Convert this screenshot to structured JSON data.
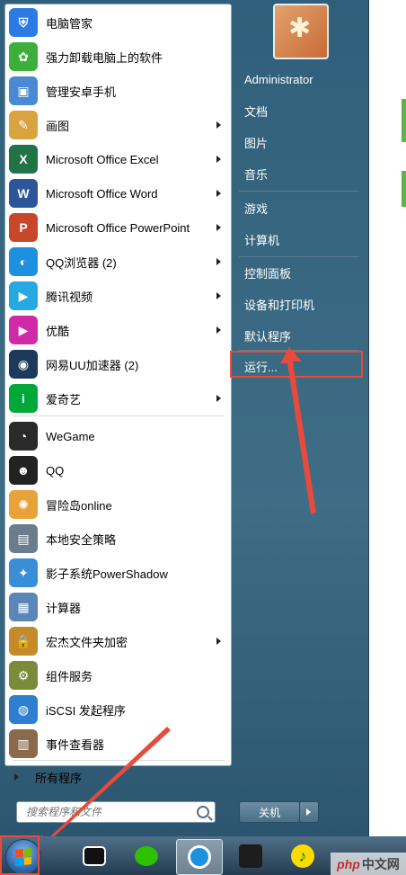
{
  "left_pane": {
    "apps": [
      {
        "label": "电脑管家",
        "icon": "tencent-pc-manager-icon",
        "color": "#2c7be5",
        "glyph": "⛨",
        "arrow": false
      },
      {
        "label": "强力卸载电脑上的软件",
        "icon": "uninstall-clover-icon",
        "color": "#3cae3c",
        "glyph": "✿",
        "arrow": false
      },
      {
        "label": "管理安卓手机",
        "icon": "android-manager-icon",
        "color": "#4a8ad4",
        "glyph": "▣",
        "arrow": false
      },
      {
        "label": "画图",
        "icon": "paint-palette-icon",
        "color": "#d9a440",
        "glyph": "✎",
        "arrow": true
      },
      {
        "label": "Microsoft Office Excel",
        "icon": "excel-icon",
        "color": "#217346",
        "glyph": "X",
        "arrow": true
      },
      {
        "label": "Microsoft Office Word",
        "icon": "word-icon",
        "color": "#2b579a",
        "glyph": "W",
        "arrow": true
      },
      {
        "label": "Microsoft Office PowerPoint",
        "icon": "powerpoint-icon",
        "color": "#c8472a",
        "glyph": "P",
        "arrow": true
      },
      {
        "label": "QQ浏览器 (2)",
        "icon": "qq-browser-icon",
        "color": "#1e90e0",
        "glyph": "◐",
        "arrow": true
      },
      {
        "label": "腾讯视频",
        "icon": "tencent-video-icon",
        "color": "#27a8e0",
        "glyph": "▶",
        "arrow": true
      },
      {
        "label": "优酷",
        "icon": "youku-icon",
        "color": "#d12aa8",
        "glyph": "▶",
        "arrow": true
      },
      {
        "label": "网易UU加速器 (2)",
        "icon": "uu-accelerator-icon",
        "color": "#1d3a5a",
        "glyph": "◉",
        "arrow": false
      },
      {
        "label": "爱奇艺",
        "icon": "iqiyi-icon",
        "color": "#00a83a",
        "glyph": "i",
        "arrow": true
      },
      {
        "label": "WeGame",
        "icon": "wegame-icon",
        "color": "#2a2a2a",
        "glyph": "◔",
        "arrow": false
      },
      {
        "label": "QQ",
        "icon": "qq-penguin-icon",
        "color": "#222222",
        "glyph": "☻",
        "arrow": false
      },
      {
        "label": "冒险岛online",
        "icon": "maplestory-icon",
        "color": "#e8a23a",
        "glyph": "✺",
        "arrow": false
      },
      {
        "label": "本地安全策略",
        "icon": "local-security-policy-icon",
        "color": "#6b7c8c",
        "glyph": "▤",
        "arrow": false
      },
      {
        "label": "影子系统PowerShadow",
        "icon": "powershadow-icon",
        "color": "#3a8ed8",
        "glyph": "✦",
        "arrow": false
      },
      {
        "label": "计算器",
        "icon": "calculator-icon",
        "color": "#5a86b8",
        "glyph": "▦",
        "arrow": false
      },
      {
        "label": "宏杰文件夹加密",
        "icon": "folder-lock-icon",
        "color": "#c58a2a",
        "glyph": "🔒",
        "arrow": true
      },
      {
        "label": "组件服务",
        "icon": "component-services-icon",
        "color": "#7a8c3a",
        "glyph": "⚙",
        "arrow": false
      },
      {
        "label": "iSCSI 发起程序",
        "icon": "iscsi-globe-icon",
        "color": "#2f7fd0",
        "glyph": "◍",
        "arrow": false
      },
      {
        "label": "事件查看器",
        "icon": "event-viewer-icon",
        "color": "#8a6a4a",
        "glyph": "▥",
        "arrow": false
      }
    ],
    "all_programs": "所有程序",
    "search_placeholder": "搜索程序和文件"
  },
  "right_pane": {
    "items": [
      {
        "label": "Administrator"
      },
      {
        "label": "文档"
      },
      {
        "label": "图片"
      },
      {
        "label": "音乐"
      },
      {
        "label": "游戏"
      },
      {
        "label": "计算机"
      },
      {
        "label": "控制面板"
      },
      {
        "label": "设备和打印机"
      },
      {
        "label": "默认程序"
      },
      {
        "label": "运行..."
      }
    ],
    "shutdown_label": "关机"
  },
  "colors": {
    "highlight": "#e84a3c",
    "accent": "#2f5f7a"
  },
  "watermark": {
    "brand": "php",
    "site": "中文网"
  }
}
